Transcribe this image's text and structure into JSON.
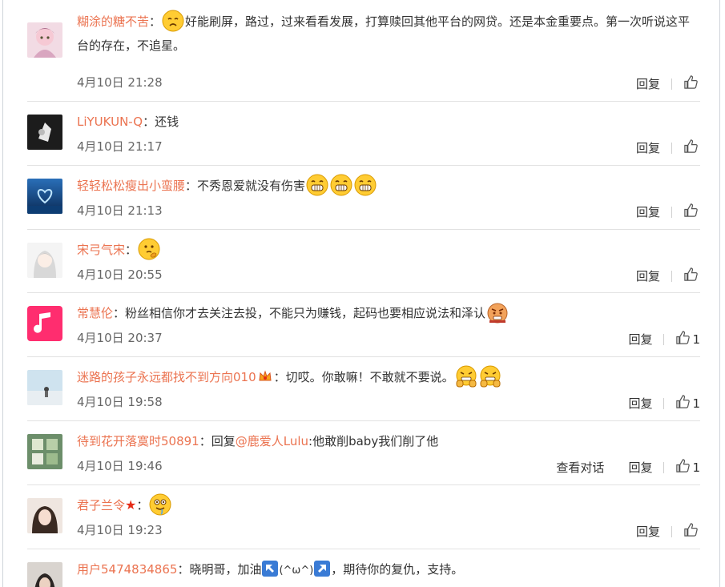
{
  "comments": [
    {
      "username": "糊涂的糖不苦",
      "text_before": "",
      "text_after": "好能刷屏，路过，过来看看发展，打算赎回其他平台的网贷。还是本金重要点。第一次听说这平台的存在，不追星。",
      "emoticon": "sad-face-emoticon",
      "time": "4月10日 21:28",
      "reply_label": "回复",
      "likes": ""
    },
    {
      "username": "LiYUKUN-Q",
      "text_after": "还钱",
      "time": "4月10日 21:17",
      "reply_label": "回复",
      "likes": ""
    },
    {
      "username": "轻轻松松瘦出小蛮腰",
      "text_after": "不秀恩爱就没有伤害",
      "emoticon": "grin-face-emoticon",
      "time": "4月10日 21:13",
      "reply_label": "回复",
      "likes": ""
    },
    {
      "username": "宋弓气宋",
      "text_after": "",
      "emoticon": "thinking-face-emoticon",
      "time": "4月10日 20:55",
      "reply_label": "回复",
      "likes": ""
    },
    {
      "username": "常慧伦",
      "text_after": "粉丝相信你才去关注去投，不能只为赚钱，起码也要相应说法和泽认",
      "emoticon": "angry-face-emoticon",
      "time": "4月10日 20:37",
      "reply_label": "回复",
      "likes": "1"
    },
    {
      "username": "迷路的孩子永远都找不到方向010",
      "text_after": "切哎。你敢嘛！不敢就不要说。",
      "emoticon": "fist-face-emoticon",
      "time": "4月10日 19:58",
      "reply_label": "回复",
      "likes": "1"
    },
    {
      "username": "待到花开落寞时50891",
      "reply_prefix": "回复",
      "mention": "@鹿爱人Lulu",
      "text_after": ":他敢削baby我们削了他",
      "time": "4月10日 19:46",
      "view_conversation": "查看对话",
      "reply_label": "回复",
      "likes": "1"
    },
    {
      "username": "君子兰令",
      "text_after": "",
      "emoticon": "drool-face-emoticon",
      "time": "4月10日 19:23",
      "reply_label": "回复",
      "likes": ""
    },
    {
      "username": "用户5474834865",
      "text_before_arrow": "晓明哥，加油",
      "kaomoji": "(^ω^)",
      "text_after": "，期待你的复仇，支持。"
    }
  ],
  "colors": {
    "username": "#eb7350",
    "text": "#333333",
    "time": "#666666",
    "divider": "#e2e2e2"
  }
}
